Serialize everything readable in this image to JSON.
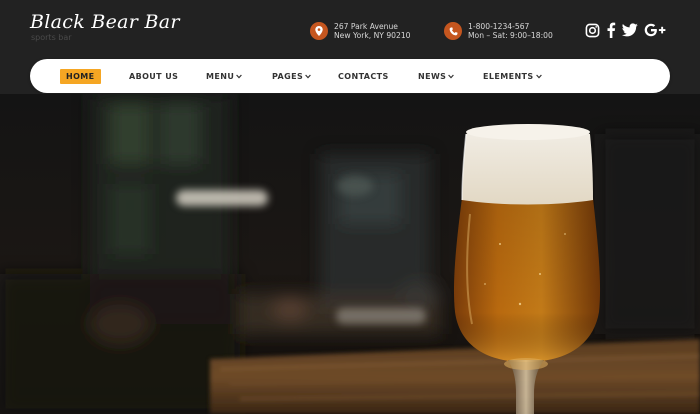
{
  "brand": {
    "name": "Black Bear Bar",
    "tagline": "sports bar"
  },
  "contact": {
    "address_line1": "267 Park Avenue",
    "address_line2": "New York, NY 90210",
    "phone": "1-800-1234-567",
    "hours": "Mon – Sat: 9:00–18:00",
    "icons": [
      "location-pin-icon",
      "phone-icon"
    ],
    "icon_color": "#c5561f"
  },
  "socials": [
    "instagram",
    "facebook",
    "twitter",
    "google-plus"
  ],
  "nav": {
    "active_color": "#f5a623",
    "items": [
      {
        "label": "HOME",
        "active": true
      },
      {
        "label": "ABOUT US"
      },
      {
        "label": "MENU",
        "dropdown": true
      },
      {
        "label": "PAGES",
        "dropdown": true
      },
      {
        "label": "CONTACTS"
      },
      {
        "label": "NEWS",
        "dropdown": true
      },
      {
        "label": "ELEMENTS",
        "dropdown": true
      }
    ]
  },
  "hero": {
    "image": "glass of beer on a wooden bar counter with blurred bar interior"
  }
}
